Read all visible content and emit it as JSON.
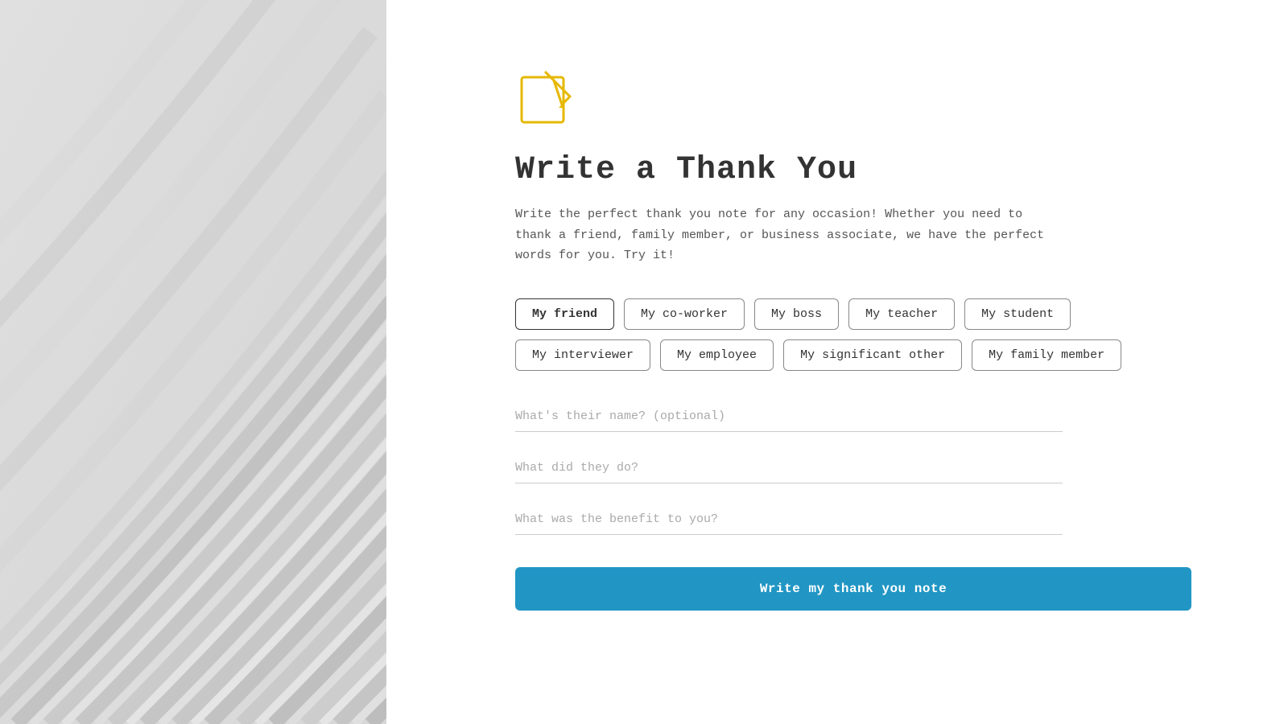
{
  "leftPanel": {
    "ariaLabel": "Decorative wave pattern"
  },
  "header": {
    "iconAlt": "Write note icon",
    "title": "Write a Thank You",
    "description": "Write the perfect thank you note for any occasion! Whether you need to thank a friend, family member, or business associate, we have the perfect words for you. Try it!"
  },
  "tags": {
    "row1": [
      {
        "id": "friend",
        "label": "My friend",
        "selected": true
      },
      {
        "id": "coworker",
        "label": "My co-worker",
        "selected": false
      },
      {
        "id": "boss",
        "label": "My boss",
        "selected": false
      },
      {
        "id": "teacher",
        "label": "My teacher",
        "selected": false
      },
      {
        "id": "student",
        "label": "My student",
        "selected": false
      }
    ],
    "row2": [
      {
        "id": "interviewer",
        "label": "My interviewer",
        "selected": false
      },
      {
        "id": "employee",
        "label": "My employee",
        "selected": false
      },
      {
        "id": "significant-other",
        "label": "My significant other",
        "selected": false
      },
      {
        "id": "family-member",
        "label": "My family member",
        "selected": false
      }
    ]
  },
  "form": {
    "nameField": {
      "placeholder": "What's their name? (optional)"
    },
    "actionField": {
      "placeholder": "What did they do?"
    },
    "benefitField": {
      "placeholder": "What was the benefit to you?"
    },
    "submitButton": "Write my thank you note"
  }
}
